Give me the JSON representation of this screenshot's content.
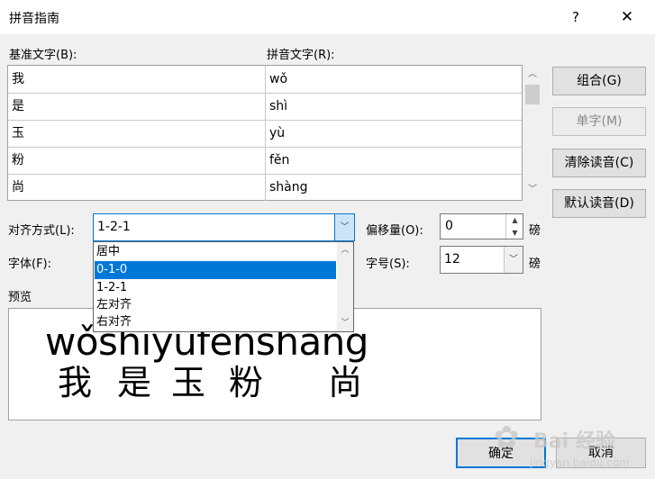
{
  "window": {
    "title": "拼音指南",
    "help": "?",
    "close": "✕"
  },
  "labels": {
    "base_text": "基准文字(B):",
    "pinyin_text": "拼音文字(R):",
    "alignment": "对齐方式(L):",
    "font": "字体(F):",
    "offset": "偏移量(O):",
    "size": "字号(S):",
    "preview": "预览",
    "unit_pound": "磅"
  },
  "rows": [
    {
      "base": "我",
      "pinyin": "wǒ"
    },
    {
      "base": "是",
      "pinyin": "shì"
    },
    {
      "base": "玉",
      "pinyin": "yù"
    },
    {
      "base": "粉",
      "pinyin": "fěn"
    },
    {
      "base": "尚",
      "pinyin": "shàng"
    }
  ],
  "buttons": {
    "combine": "组合(G)",
    "single": "单字(M)",
    "clear": "清除读音(C)",
    "default": "默认读音(D)",
    "ok": "确定",
    "cancel": "取消"
  },
  "alignment": {
    "value": "1-2-1",
    "options": [
      "居中",
      "0-1-0",
      "1-2-1",
      "左对齐",
      "右对齐"
    ],
    "highlighted_index": 1
  },
  "offset": {
    "value": "0"
  },
  "size": {
    "value": "12"
  },
  "preview": {
    "pinyin": "wǒshìyùfěnshàng",
    "chars": [
      "我",
      "是",
      "玉",
      "粉",
      "尚"
    ]
  },
  "watermark": {
    "text": "Bai 经验",
    "url": "jingyan.baidu.com"
  }
}
